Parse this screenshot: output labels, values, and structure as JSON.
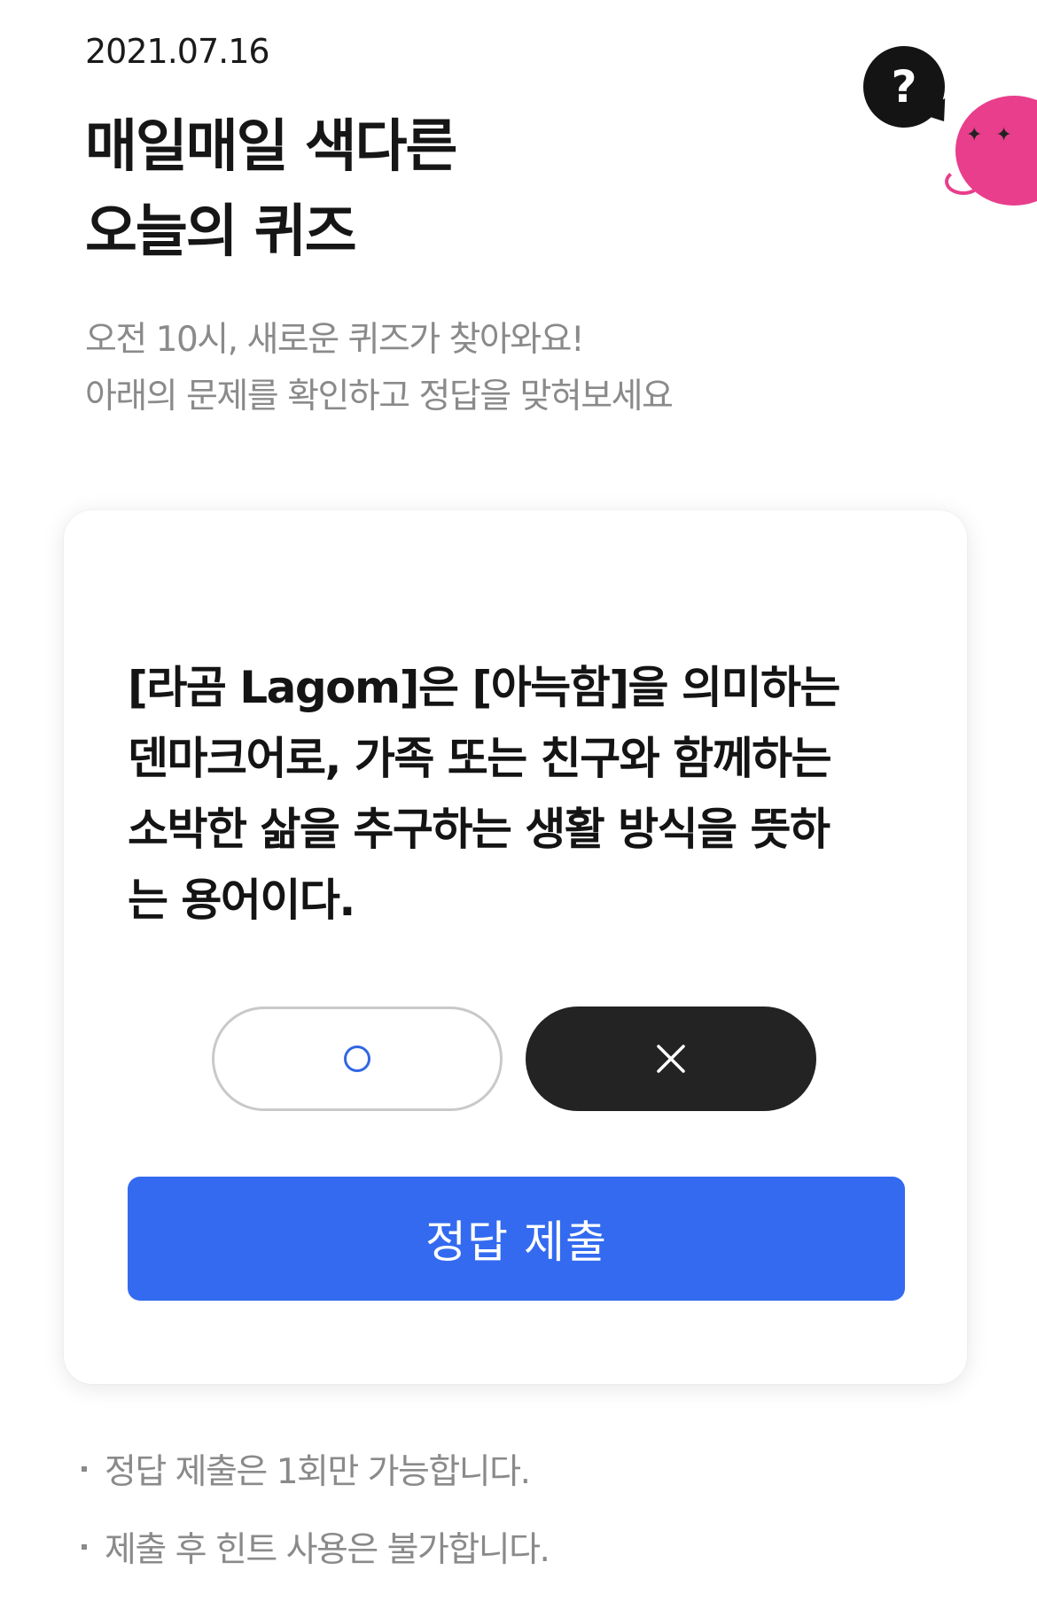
{
  "header": {
    "date": "2021.07.16",
    "title_lines": [
      "매일매일 색다른",
      "오늘의 퀴즈"
    ],
    "subtitle_lines": [
      "오전 10시, 새로운 퀴즈가 찾아와요!",
      "아래의 문제를 확인하고 정답을 맞혀보세요"
    ]
  },
  "decoration": {
    "question_bubble_text": "?",
    "mascot_eyes": "✦ ✦"
  },
  "quiz": {
    "question_lines": [
      "[라곰 Lagom]은 [아늑함]을 의미하는",
      "덴마크어로, 가족 또는 친구와 함께하는",
      "소박한 삶을 추구하는 생활 방식을 뜻하",
      "는 용어이다."
    ],
    "options": [
      {
        "icon": "circle-o-icon",
        "selected": false
      },
      {
        "icon": "x-icon",
        "selected": true
      }
    ],
    "submit_label": "정답 제출"
  },
  "notes": [
    "정답 제출은 1회만 가능합니다.",
    "제출 후 힌트 사용은 불가합니다."
  ],
  "colors": {
    "accent": "#336af0",
    "selected_option": "#232323",
    "mascot_pink": "#e83e8c",
    "circle_icon": "#3267e3"
  }
}
